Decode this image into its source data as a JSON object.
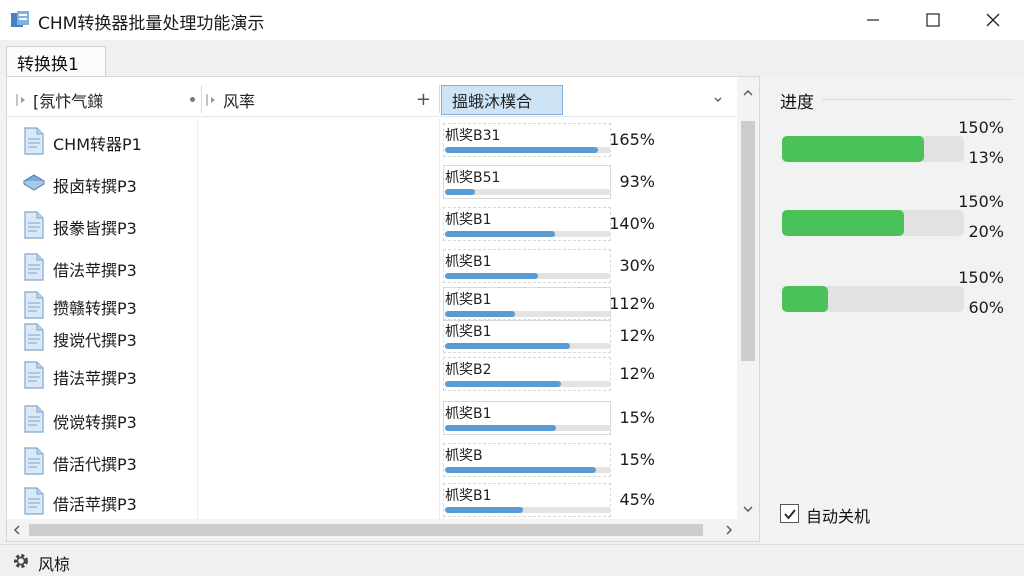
{
  "window": {
    "title": "CHM转换器批量处理功能演示",
    "icon": "app-icon",
    "controls": [
      "minimize-icon",
      "maximize-icon",
      "close-icon"
    ]
  },
  "tabs": [
    {
      "label": "转换换1"
    }
  ],
  "table": {
    "headers": [
      {
        "label": "[氛忭气鏼",
        "icon": "sort-icon"
      },
      {
        "label": "风率",
        "icon": "sort-icon"
      },
      {
        "label": "搵蛾沐樸合",
        "icon": "chevron-down-icon"
      }
    ],
    "rows": [
      {
        "icon": "document-icon",
        "name": "CHM转器P1",
        "task": "枛奖B31",
        "progress": 0.92,
        "percent": "165%"
      },
      {
        "icon": "book-icon",
        "name": "报卤转撰P3",
        "task": "枛奖B51",
        "progress": 0.18,
        "percent": "93%"
      },
      {
        "icon": "document-icon",
        "name": "报豢皆撰P3",
        "task": "枛奖B1",
        "progress": 0.66,
        "percent": "140%"
      },
      {
        "icon": "document-icon",
        "name": "借法苹撰P3",
        "task": "枛奖B1",
        "progress": 0.56,
        "percent": "30%"
      },
      {
        "icon": "document-icon",
        "name": "攒赣转撰P3",
        "task": "枛奖B1",
        "progress": 0.42,
        "percent": "112%"
      },
      {
        "icon": "document-icon",
        "name": "搜谠代撰P3",
        "task": "枛奖B1",
        "progress": 0.75,
        "percent": "12%"
      },
      {
        "icon": "document-icon",
        "name": "措法苹撰P3",
        "task": "枛奖B2",
        "progress": 0.7,
        "percent": "12%"
      },
      {
        "icon": "document-icon",
        "name": "傥谠转撰P3",
        "task": "枛奖B1",
        "progress": 0.67,
        "percent": "15%"
      },
      {
        "icon": "document-icon",
        "name": "借活代撰P3",
        "task": "枛奖B",
        "progress": 0.91,
        "percent": "15%"
      },
      {
        "icon": "document-icon",
        "name": "借活苹撰P3",
        "task": "枛奖B1",
        "progress": 0.47,
        "percent": "45%"
      }
    ]
  },
  "side_panel": {
    "title": "进度",
    "bars": [
      {
        "top_label": "150%",
        "bottom_label": "13%",
        "progress": 0.78
      },
      {
        "top_label": "150%",
        "bottom_label": "20%",
        "progress": 0.67
      },
      {
        "top_label": "150%",
        "bottom_label": "60%",
        "progress": 0.25
      }
    ]
  },
  "checkbox": {
    "label": "自动关机",
    "checked": true
  },
  "status": {
    "label": "风椋",
    "icon": "gear-icon"
  },
  "colors": {
    "progress_blue": "#5a9bd5",
    "progress_green": "#4bc15a",
    "header_highlight": "#cfe3f7"
  }
}
